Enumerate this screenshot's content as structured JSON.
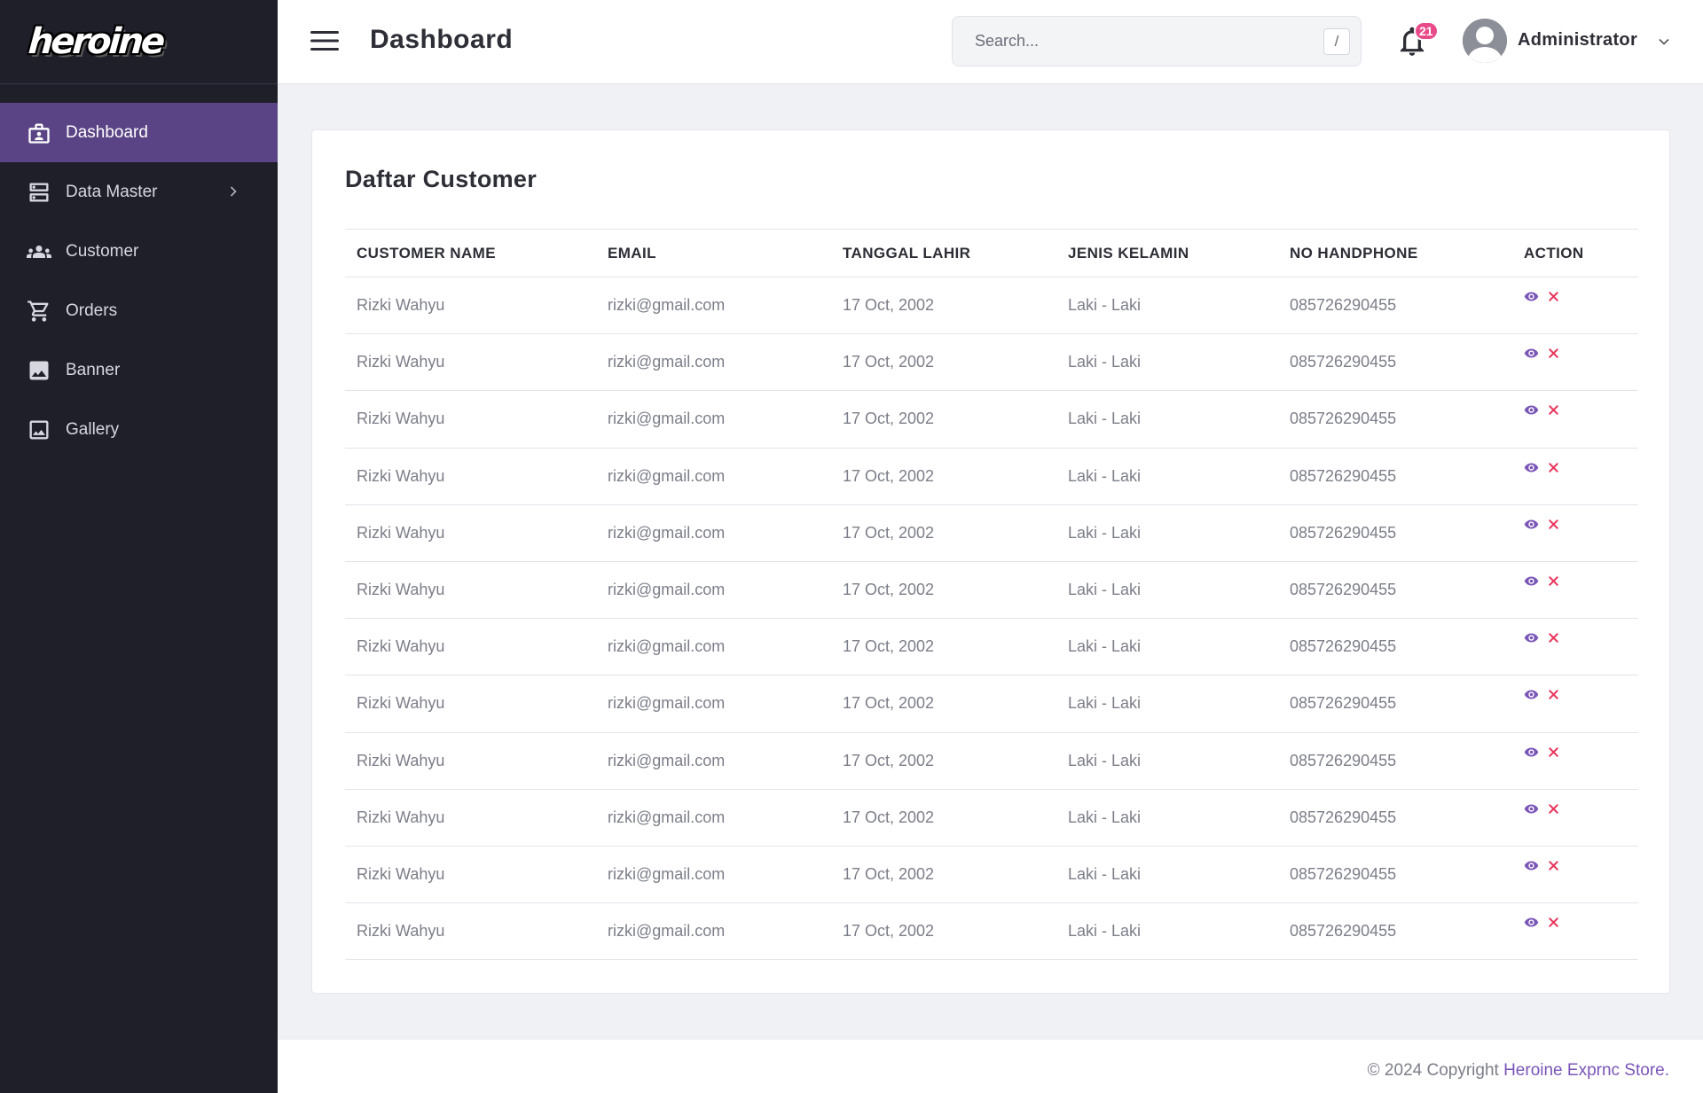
{
  "brand": {
    "logo_text": "heroine"
  },
  "sidebar": {
    "items": [
      {
        "label": "Dashboard",
        "icon": "dashboard-icon",
        "active": true
      },
      {
        "label": "Data Master",
        "icon": "server-icon",
        "has_submenu": true
      },
      {
        "label": "Customer",
        "icon": "people-icon"
      },
      {
        "label": "Orders",
        "icon": "cart-icon"
      },
      {
        "label": "Banner",
        "icon": "image-icon"
      },
      {
        "label": "Gallery",
        "icon": "gallery-icon"
      }
    ]
  },
  "header": {
    "title": "Dashboard",
    "search_placeholder": "Search...",
    "search_shortcut": "/",
    "notification_count": "21",
    "user_name": "Administrator"
  },
  "card": {
    "title": "Daftar Customer",
    "columns": [
      "CUSTOMER NAME",
      "EMAIL",
      "TANGGAL LAHIR",
      "JENIS KELAMIN",
      "NO HANDPHONE",
      "ACTION"
    ],
    "rows": [
      [
        "Rizki Wahyu",
        "rizki@gmail.com",
        "17 Oct, 2002",
        "Laki - Laki",
        "085726290455"
      ],
      [
        "Rizki Wahyu",
        "rizki@gmail.com",
        "17 Oct, 2002",
        "Laki - Laki",
        "085726290455"
      ],
      [
        "Rizki Wahyu",
        "rizki@gmail.com",
        "17 Oct, 2002",
        "Laki - Laki",
        "085726290455"
      ],
      [
        "Rizki Wahyu",
        "rizki@gmail.com",
        "17 Oct, 2002",
        "Laki - Laki",
        "085726290455"
      ],
      [
        "Rizki Wahyu",
        "rizki@gmail.com",
        "17 Oct, 2002",
        "Laki - Laki",
        "085726290455"
      ],
      [
        "Rizki Wahyu",
        "rizki@gmail.com",
        "17 Oct, 2002",
        "Laki - Laki",
        "085726290455"
      ],
      [
        "Rizki Wahyu",
        "rizki@gmail.com",
        "17 Oct, 2002",
        "Laki - Laki",
        "085726290455"
      ],
      [
        "Rizki Wahyu",
        "rizki@gmail.com",
        "17 Oct, 2002",
        "Laki - Laki",
        "085726290455"
      ],
      [
        "Rizki Wahyu",
        "rizki@gmail.com",
        "17 Oct, 2002",
        "Laki - Laki",
        "085726290455"
      ],
      [
        "Rizki Wahyu",
        "rizki@gmail.com",
        "17 Oct, 2002",
        "Laki - Laki",
        "085726290455"
      ],
      [
        "Rizki Wahyu",
        "rizki@gmail.com",
        "17 Oct, 2002",
        "Laki - Laki",
        "085726290455"
      ],
      [
        "Rizki Wahyu",
        "rizki@gmail.com",
        "17 Oct, 2002",
        "Laki - Laki",
        "085726290455"
      ]
    ],
    "row_actions": [
      {
        "icon": "eye-icon",
        "name": "view-button"
      },
      {
        "icon": "close-icon",
        "name": "delete-button"
      }
    ]
  },
  "footer": {
    "copyright_prefix": "© 2024 Copyright ",
    "store_link": "Heroine Exprnc Store."
  },
  "colors": {
    "sidebar_bg": "#1e1f29",
    "active_item": "#5a4485",
    "accent_purple": "#7a56b8",
    "delete_red": "#e8365d",
    "badge": "#e84a8a"
  }
}
